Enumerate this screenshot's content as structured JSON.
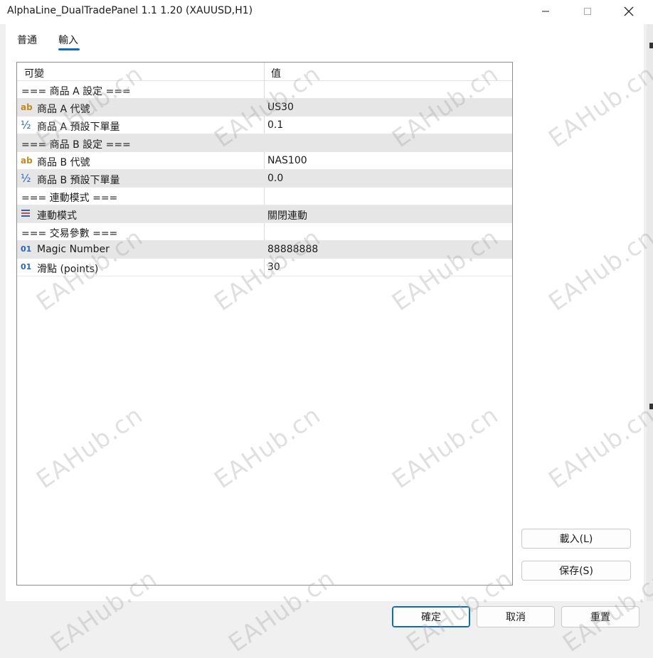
{
  "window": {
    "title": "AlphaLine_DualTradePanel 1.1 1.20 (XAUUSD,H1)",
    "icons": [
      "minimize-icon",
      "maximize-icon",
      "close-icon"
    ]
  },
  "tabs": [
    {
      "label": "普通",
      "active": false
    },
    {
      "label": "輸入",
      "active": true
    }
  ],
  "grid": {
    "headers": {
      "variable": "可變",
      "value": "值"
    },
    "rows": [
      {
        "name": "=== 商品 A 設定 ===",
        "value": "",
        "icon": ""
      },
      {
        "name": "商品 A 代號",
        "value": "US30",
        "icon": "ab"
      },
      {
        "name": "商品 A 預設下單量",
        "value": "0.1",
        "icon": "½"
      },
      {
        "name": "=== 商品 B 設定 ===",
        "value": "",
        "icon": ""
      },
      {
        "name": "商品 B 代號",
        "value": "NAS100",
        "icon": "ab"
      },
      {
        "name": "商品 B 預設下單量",
        "value": "0.0",
        "icon": "½"
      },
      {
        "name": "=== 連動模式 ===",
        "value": "",
        "icon": ""
      },
      {
        "name": "連動模式",
        "value": "關閉連動",
        "icon": "enum"
      },
      {
        "name": "=== 交易參數 ===",
        "value": "",
        "icon": ""
      },
      {
        "name": "Magic Number",
        "value": "88888888",
        "icon": "01"
      },
      {
        "name": "滑點 (points)",
        "value": "30",
        "icon": "01"
      }
    ]
  },
  "buttons": {
    "load": "載入(L)",
    "save": "保存(S)",
    "ok": "確定",
    "cancel": "取消",
    "reset": "重置"
  },
  "watermark": "EAHub.cn",
  "colors": {
    "accent": "#0f6cbd",
    "string_icon": "#c08a1e",
    "number_icon": "#2a64b8",
    "row_shade": "#e6e6e6"
  }
}
